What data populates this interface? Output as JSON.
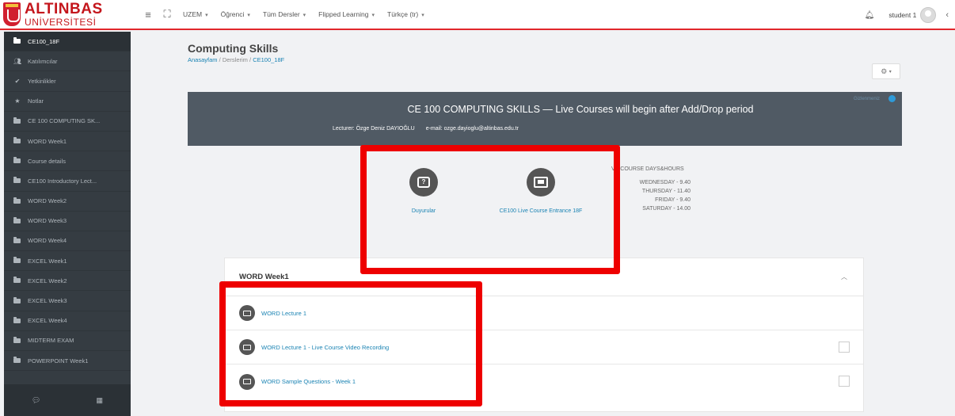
{
  "brand": {
    "name": "ALTINBAS",
    "subtitle": "UNİVERSİTESİ"
  },
  "navbar": {
    "items": [
      {
        "label": "UZEM",
        "caret": "▾"
      },
      {
        "label": "Öğrenci",
        "caret": "▾"
      },
      {
        "label": "Tüm Dersler",
        "caret": "▾"
      },
      {
        "label": "Flipped Learning",
        "caret": "▾"
      },
      {
        "label": "Türkçe (tr)",
        "caret": "▾"
      }
    ],
    "user": "student 1"
  },
  "sidebar": {
    "items": [
      {
        "label": "CE100_18F",
        "icon": "folder-icon"
      },
      {
        "label": "Katılımcılar",
        "icon": "users-icon"
      },
      {
        "label": "Yetkinlikler",
        "icon": "check-icon"
      },
      {
        "label": "Notlar",
        "icon": "star-icon"
      },
      {
        "label": "CE 100 COMPUTING SK...",
        "icon": "folder-icon"
      },
      {
        "label": "WORD Week1",
        "icon": "folder-icon"
      },
      {
        "label": "Course details",
        "icon": "folder-icon"
      },
      {
        "label": "CE100 Introductory Lect...",
        "icon": "folder-icon"
      },
      {
        "label": "WORD Week2",
        "icon": "folder-icon"
      },
      {
        "label": "WORD Week3",
        "icon": "folder-icon"
      },
      {
        "label": "WORD Week4",
        "icon": "folder-icon"
      },
      {
        "label": "EXCEL Week1",
        "icon": "folder-icon"
      },
      {
        "label": "EXCEL Week2",
        "icon": "folder-icon"
      },
      {
        "label": "EXCEL Week3",
        "icon": "folder-icon"
      },
      {
        "label": "EXCEL Week4",
        "icon": "folder-icon"
      },
      {
        "label": "MIDTERM EXAM",
        "icon": "folder-icon"
      },
      {
        "label": "POWERPOINT Week1",
        "icon": "folder-icon"
      }
    ]
  },
  "page": {
    "title": "Computing Skills",
    "breadcrumb": [
      "Anasayfam",
      "Derslerim",
      "CE100_18F"
    ],
    "breadcrumb_sep": "/"
  },
  "banner": {
    "title": "CE 100 COMPUTING SKILLS — Live Courses will begin after Add/Drop period",
    "lecturer": "Lecturer: Özge Deniz DAYIOĞLU",
    "email": "e-mail: ozge.dayioglu@altinbas.edu.tr",
    "corner": "Gizlenmeniz"
  },
  "tiles": [
    {
      "label": "Duyurular",
      "icon": "announcement-icon"
    },
    {
      "label": "CE100 Live Course Entrance 18F",
      "icon": "live-course-icon"
    }
  ],
  "schedule": {
    "title": "VE COURSE DAYS&HOURS",
    "days": [
      "WEDNESDAY - 9.40",
      "THURSDAY - 11.40",
      "FRIDAY - 9.40",
      "SATURDAY - 14.00"
    ]
  },
  "section": {
    "title": "WORD Week1",
    "activities": [
      {
        "label": "WORD Lecture 1",
        "checkbox": false
      },
      {
        "label": "WORD Lecture 1 - Live Course Video Recording",
        "checkbox": true
      },
      {
        "label": "WORD Sample Questions - Week 1",
        "checkbox": true
      }
    ]
  }
}
